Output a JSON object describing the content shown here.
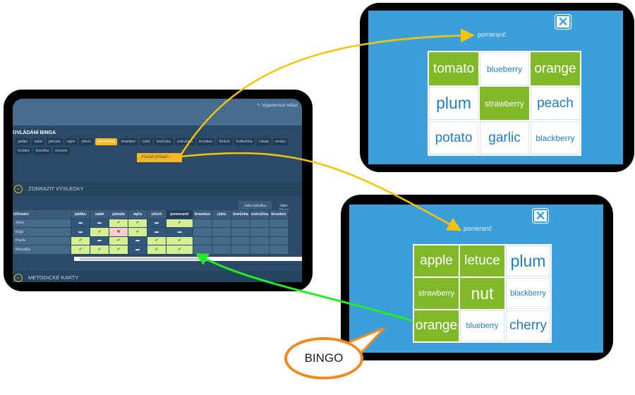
{
  "admin": {
    "generate_link": "Vygenerovat odkaz",
    "heading": "OVLÁDÁNÍ BINGA",
    "tags": [
      "jablko",
      "salát",
      "jahoda",
      "rajče",
      "ořech",
      "pomeranč",
      "brambor",
      "rybíz",
      "borůvka",
      "ostružina",
      "broskev",
      "třešeň",
      "ředkvička",
      "cibule",
      "mrkev",
      "hruška",
      "švestka",
      "česnek"
    ],
    "selected_tag": "pomeranč",
    "send_button": "Poslat příklad",
    "results_section": "ZOBRAZIT VÝSLEDKY",
    "cards_section": "METODICKÉ KARTY",
    "view_table": "Jako tabulka",
    "view_bingo": "Jako bingo",
    "table": {
      "user_header": "Uživatel:",
      "columns": [
        "jablko",
        "salát",
        "jahoda",
        "rajče",
        "ořech",
        "pomeranč",
        "brambor",
        "rybíz",
        "borůvka",
        "ostružina",
        "broskev"
      ],
      "rows": [
        {
          "user": "Jirka",
          "results": [
            "none",
            "none",
            "ok",
            "ok",
            "none",
            "ok"
          ]
        },
        {
          "user": "Kája",
          "results": [
            "none",
            "ok",
            "wrong",
            "ok",
            "none",
            "none"
          ]
        },
        {
          "user": "Pavla",
          "results": [
            "ok",
            "none",
            "ok",
            "none",
            "ok",
            "ok"
          ]
        },
        {
          "user": "Maruška",
          "results": [
            "ok",
            "ok",
            "ok",
            "none",
            "ok",
            "ok"
          ]
        }
      ]
    }
  },
  "card1": {
    "word": "pomeranč",
    "cells": [
      {
        "t": "tomato",
        "g": true
      },
      {
        "t": "blueberry",
        "g": false
      },
      {
        "t": "orange",
        "g": true
      },
      {
        "t": "plum",
        "g": false
      },
      {
        "t": "strawberry",
        "g": true
      },
      {
        "t": "peach",
        "g": false
      },
      {
        "t": "potato",
        "g": false
      },
      {
        "t": "garlic",
        "g": false
      },
      {
        "t": "blackberry",
        "g": false
      }
    ]
  },
  "card2": {
    "word": "pomeranč",
    "cells": [
      {
        "t": "apple",
        "g": true
      },
      {
        "t": "letuce",
        "g": true
      },
      {
        "t": "plum",
        "g": false
      },
      {
        "t": "strawberry",
        "g": true
      },
      {
        "t": "nut",
        "g": true
      },
      {
        "t": "blackberry",
        "g": false
      },
      {
        "t": "orange",
        "g": true
      },
      {
        "t": "blueberry",
        "g": false
      },
      {
        "t": "cherry",
        "g": false
      }
    ]
  },
  "callout": "BINGO",
  "colors": {
    "selected": "#7fb92a",
    "accent": "#f5b822",
    "card_bg": "#3c9fd9",
    "arrow_green": "#22ee22"
  }
}
